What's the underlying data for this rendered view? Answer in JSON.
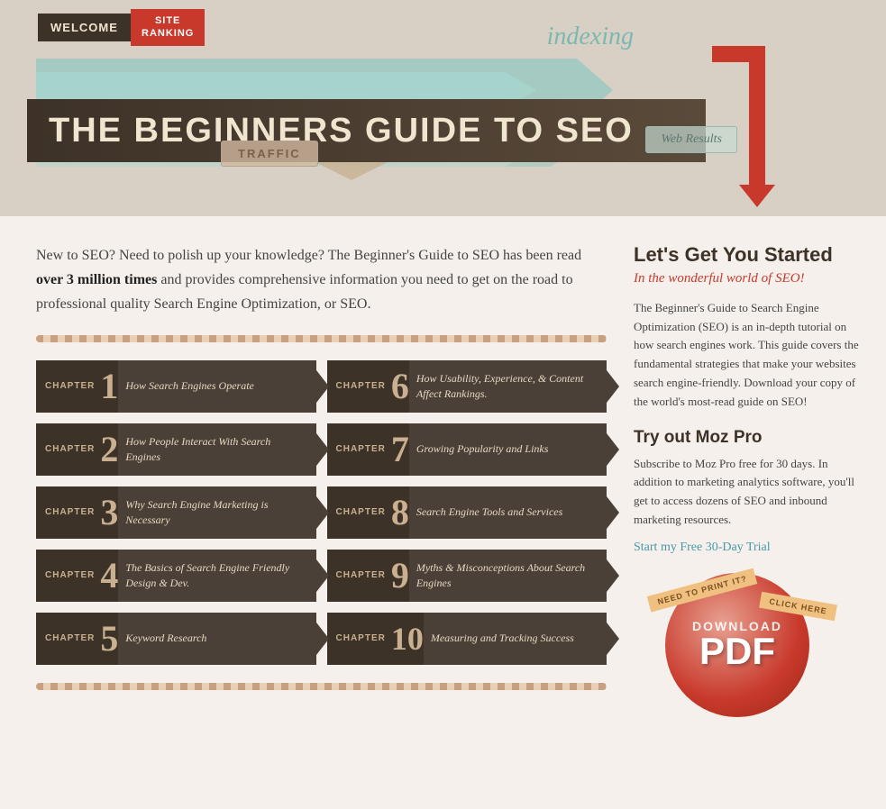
{
  "header": {
    "welcome_label": "WELCOME",
    "site_ranking_label": "SITE\nRANKING",
    "indexing_label": "indexing",
    "web_results_label": "Web Results",
    "traffic_label": "TRAFFIC",
    "main_title": "THE BEGINNERS GUIDE TO SEO"
  },
  "intro": {
    "text_before_bold": "New to SEO? Need to polish up your knowledge? The Beginner's Guide to SEO has been read ",
    "bold_text": "over 3 million times",
    "text_after_bold": " and provides comprehensive information you need to get on the road to professional quality Search Engine Optimization, or SEO."
  },
  "chapters": [
    {
      "number": "1",
      "word": "CHAPTER",
      "title": "How Search Engines Operate"
    },
    {
      "number": "6",
      "word": "CHAPTER",
      "title": "How Usability, Experience, & Content Affect Rankings."
    },
    {
      "number": "2",
      "word": "CHAPTER",
      "title": "How People Interact With Search Engines"
    },
    {
      "number": "7",
      "word": "CHAPTER",
      "title": "Growing Popularity and Links"
    },
    {
      "number": "3",
      "word": "CHAPTER",
      "title": "Why Search Engine Marketing is Necessary"
    },
    {
      "number": "8",
      "word": "CHAPTER",
      "title": "Search Engine Tools and Services"
    },
    {
      "number": "4",
      "word": "CHAPTER",
      "title": "The Basics of Search Engine Friendly Design & Dev."
    },
    {
      "number": "9",
      "word": "CHAPTER",
      "title": "Myths & Misconceptions About Search Engines"
    },
    {
      "number": "5",
      "word": "CHAPTER",
      "title": "Keyword Research"
    },
    {
      "number": "10",
      "word": "CHAPTER",
      "title": "Measuring and Tracking Success"
    }
  ],
  "sidebar": {
    "heading": "Let's Get You Started",
    "subheading": "In the wonderful world of SEO!",
    "body": "The Beginner's Guide to Search Engine Optimization (SEO) is an in-depth tutorial on how search engines work. This guide covers the fundamental strategies that make your websites search engine-friendly. Download your copy of the world's most-read guide on SEO!",
    "moz_heading": "Try out Moz Pro",
    "moz_body": "Subscribe to Moz Pro free for 30 days. In addition to marketing analytics software, you'll get to access dozens of SEO and inbound marketing resources.",
    "moz_link": "Start my Free 30-Day Trial",
    "pdf_need_label": "NEED TO PRINT IT?",
    "pdf_click_label": "CLICK HERE",
    "pdf_download_label": "DOWNLOAD",
    "pdf_text": "PDF"
  },
  "colors": {
    "accent_red": "#c8392b",
    "dark_brown": "#3d3228",
    "teal": "#7ab8b0",
    "link_teal": "#4a9aaa",
    "tan": "#c8b090"
  }
}
